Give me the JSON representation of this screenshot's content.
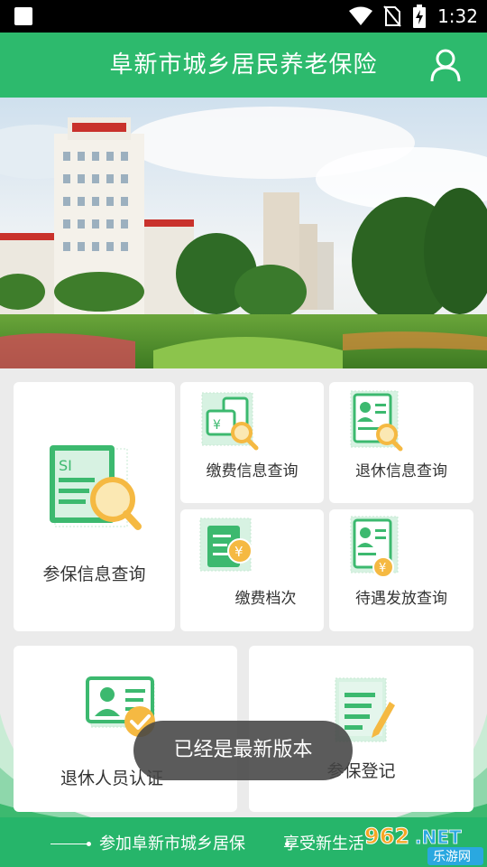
{
  "status_bar": {
    "time": "1:32",
    "icons": [
      "notification-square-icon",
      "wifi-icon",
      "no-sim-icon",
      "battery-charging-icon"
    ]
  },
  "header": {
    "title": "阜新市城乡居民养老保险",
    "user_icon": "user-icon"
  },
  "banner": {
    "image": "city-building-park-photo"
  },
  "menu": {
    "insurance_info": {
      "label": "参保信息查询",
      "icon": "si-document-search-icon"
    },
    "payment_info": {
      "label": "缴费信息查询",
      "icon": "payment-search-icon"
    },
    "retire_info": {
      "label": "退休信息查询",
      "icon": "retire-id-search-icon"
    },
    "payment_level": {
      "label": "缴费档次",
      "icon": "payment-level-icon"
    },
    "benefit_query": {
      "label": "待遇发放查询",
      "icon": "benefit-id-coin-icon"
    },
    "retiree_auth": {
      "label": "退休人员认证",
      "icon": "id-card-check-icon"
    },
    "enroll": {
      "label": "参保登记",
      "icon": "document-pen-icon"
    }
  },
  "footer": {
    "slogan_part1": "参加阜新市城乡居保",
    "slogan_part2": "享受新生活"
  },
  "toast": {
    "message": "已经是最新版本"
  },
  "watermark": {
    "text_top": "962.NET",
    "text_bottom": "乐游网"
  },
  "colors": {
    "primary": "#2dba6d",
    "icon_green": "#3cb96f",
    "icon_orange": "#f5b942",
    "card_bg": "#ffffff",
    "page_bg": "#ebebeb"
  }
}
